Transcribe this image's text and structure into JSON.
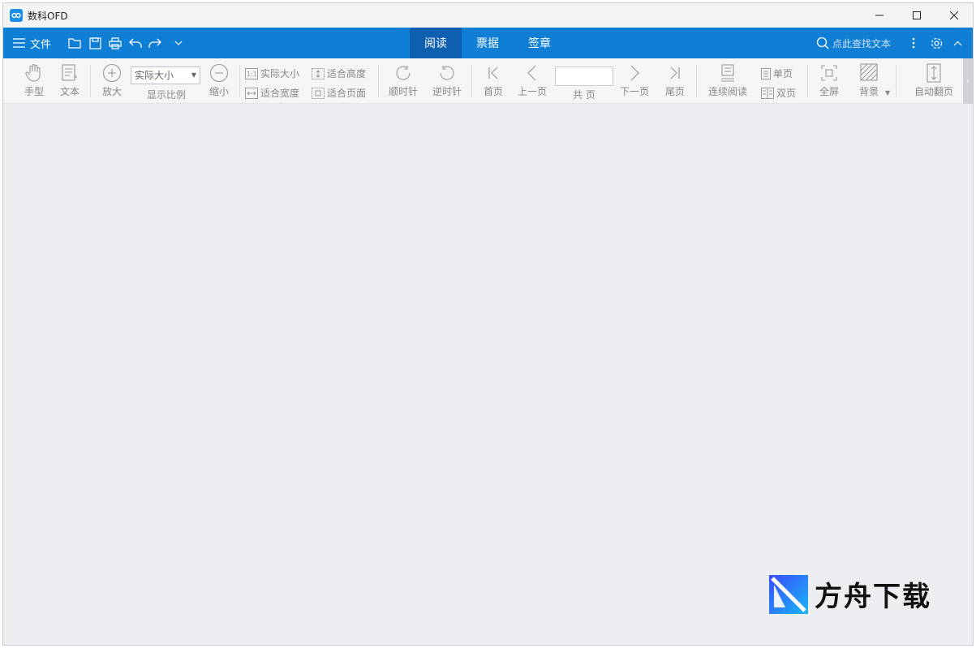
{
  "app": {
    "title": "数科OFD"
  },
  "menu": {
    "file_label": "文件",
    "tabs": [
      {
        "label": "阅读",
        "active": true
      },
      {
        "label": "票据",
        "active": false
      },
      {
        "label": "签章",
        "active": false
      }
    ],
    "search_placeholder": "点此查找文本"
  },
  "toolbar": {
    "hand": "手型",
    "text": "文本",
    "zoom_in": "放大",
    "zoom_select_value": "实际大小",
    "zoom_ratio": "显示比例",
    "zoom_out": "缩小",
    "actual_size": "实际大小",
    "fit_width": "适合宽度",
    "fit_height": "适合高度",
    "fit_page": "适合页面",
    "rotate_cw": "顺时针",
    "rotate_ccw": "逆时针",
    "first_page": "首页",
    "prev_page": "上一页",
    "total_pages": "共 页",
    "next_page": "下一页",
    "last_page": "尾页",
    "continuous": "连续阅读",
    "single_page": "单页",
    "double_page": "双页",
    "fullscreen": "全屏",
    "background": "背景",
    "auto_flip": "自动翻页"
  },
  "watermark": {
    "text": "方舟下载"
  },
  "colors": {
    "menubar": "#0f7fd6",
    "active_tab": "#0e5fb0",
    "content_bg": "#eceef2"
  }
}
